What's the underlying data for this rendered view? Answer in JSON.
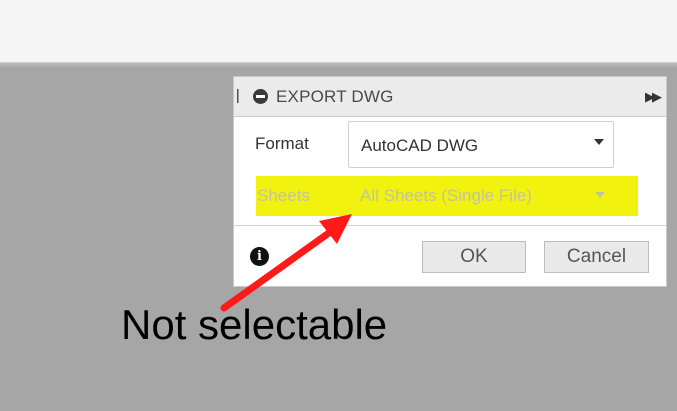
{
  "dialog": {
    "title": "EXPORT DWG",
    "format": {
      "label": "Format",
      "value": "AutoCAD DWG"
    },
    "sheets": {
      "label": "Sheets",
      "value": "All Sheets (Single File)",
      "enabled": false
    },
    "buttons": {
      "ok": "OK",
      "cancel": "Cancel"
    }
  },
  "annotation": {
    "text": "Not selectable",
    "arrow_color": "#ff1a1a",
    "highlight_color": "#f2f20f"
  }
}
